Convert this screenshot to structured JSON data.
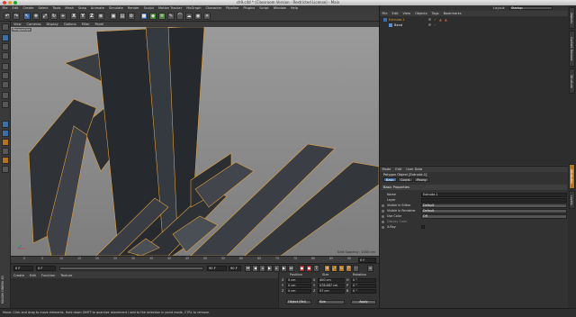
{
  "window": {
    "title": "ch9.c4d * (Classroom Version - Restricted License) - Main",
    "layout_label": "Layout:",
    "layout_value": "Startup"
  },
  "main_menu": [
    "File",
    "Edit",
    "Create",
    "Select",
    "Tools",
    "Mesh",
    "Snap",
    "Animate",
    "Simulate",
    "Render",
    "Sculpt",
    "Motion Tracker",
    "MoGraph",
    "Character",
    "Pipeline",
    "Plugins",
    "Script",
    "Window",
    "Help"
  ],
  "toolbar": {
    "x": "X",
    "y": "Y",
    "z": "Z"
  },
  "viewport": {
    "menu": [
      "View",
      "Cameras",
      "Display",
      "Options",
      "Filter",
      "Panel"
    ],
    "camera_label": "Perspective",
    "grid_spacing": "Grid Spacing : 1000 cm"
  },
  "timeline": {
    "ticks": [
      "0",
      "5",
      "10",
      "15",
      "20",
      "25",
      "30",
      "35",
      "40",
      "45",
      "50",
      "55",
      "60",
      "65",
      "70",
      "75",
      "80",
      "85",
      "90"
    ],
    "current_frame": "0 F",
    "start_frame": "0 F",
    "end_frame": "90 F",
    "end_field": "90 F",
    "frame_end_display": "0 F"
  },
  "material_manager": {
    "menu": [
      "Create",
      "Edit",
      "Function",
      "Texture"
    ],
    "side_label": "MAXON CINEMA 4D"
  },
  "coordinates": {
    "headers": [
      "Position",
      "Size",
      "Rotation"
    ],
    "rows": [
      {
        "axis": "X",
        "pos": "0 cm",
        "size_axis": "X",
        "size": "400 cm",
        "rot_axis": "H",
        "rot": "0 °"
      },
      {
        "axis": "Y",
        "pos": "0 cm",
        "size_axis": "Y",
        "size": "578.687 cm",
        "rot_axis": "P",
        "rot": "0 °"
      },
      {
        "axis": "Z",
        "pos": "0 cm",
        "size_axis": "Z",
        "size": "57 cm",
        "rot_axis": "B",
        "rot": "0 °"
      }
    ],
    "mode_dropdown": "Object (Rel)",
    "size_dropdown": "Size",
    "apply_label": "Apply"
  },
  "object_manager": {
    "menu": [
      "File",
      "Edit",
      "View",
      "Objects",
      "Tags",
      "Bookmarks"
    ],
    "objects": [
      {
        "name": "Extrude.1",
        "selected": true
      },
      {
        "name": "Bend",
        "selected": false
      }
    ]
  },
  "attributes": {
    "menu": [
      "Mode",
      "Edit",
      "User Data"
    ],
    "title": "Polygon Object [Extrude.1]",
    "tabs": [
      "Basic",
      "Coord.",
      "Phong"
    ],
    "section": "Basic Properties",
    "fields": [
      {
        "label": "Name",
        "value": "Extrude.1",
        "type": "text",
        "dim": false
      },
      {
        "label": "Layer",
        "value": "",
        "type": "text",
        "dim": false
      },
      {
        "label": "Visible in Editor",
        "value": "Default",
        "type": "dropdown",
        "dim": false
      },
      {
        "label": "Visible in Renderer",
        "value": "Default",
        "type": "dropdown",
        "dim": false
      },
      {
        "label": "Use Color",
        "value": "Off",
        "type": "dropdown",
        "dim": false
      },
      {
        "label": "Display Color",
        "value": "",
        "type": "none",
        "dim": true
      },
      {
        "label": "X-Ray",
        "value": "",
        "type": "check",
        "dim": false
      }
    ]
  },
  "side_tabs": [
    "Objects",
    "Content Browser",
    "Structure",
    "Attributes",
    "Layers"
  ],
  "status_bar": "Move: Click and drag to move elements. Hold down SHIFT to quantize movement / add to the selection in point mode, CTRL to remove.",
  "colors": {
    "viewport_bg": "#8d8d8d",
    "selection_outline": "#e0a040",
    "accent_blue": "#3d6ea8",
    "accent_orange": "#b8741a"
  }
}
